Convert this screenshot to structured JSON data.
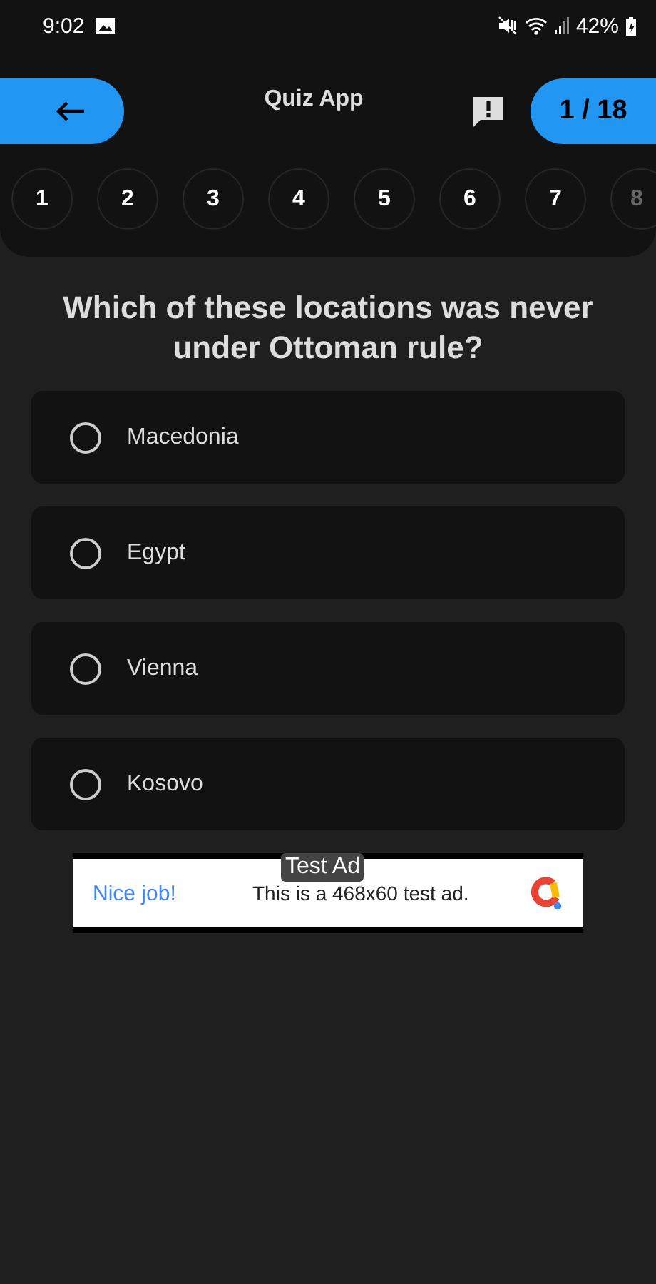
{
  "status_bar": {
    "time": "9:02",
    "battery": "42%"
  },
  "app_bar": {
    "title": "Quiz App",
    "counter": "1 / 18"
  },
  "question_numbers": [
    {
      "label": "1",
      "dimmed": false
    },
    {
      "label": "2",
      "dimmed": false
    },
    {
      "label": "3",
      "dimmed": false
    },
    {
      "label": "4",
      "dimmed": false
    },
    {
      "label": "5",
      "dimmed": false
    },
    {
      "label": "6",
      "dimmed": false
    },
    {
      "label": "7",
      "dimmed": false
    },
    {
      "label": "8",
      "dimmed": true
    }
  ],
  "question": "Which of these locations was never under Ottoman rule?",
  "options": [
    {
      "label": "Macedonia",
      "selected": false
    },
    {
      "label": "Egypt",
      "selected": false
    },
    {
      "label": "Vienna",
      "selected": false
    },
    {
      "label": "Kosovo",
      "selected": false
    }
  ],
  "ad": {
    "badge": "Test Ad",
    "headline": "Nice job!",
    "text": "This is a 468x60 test ad."
  }
}
